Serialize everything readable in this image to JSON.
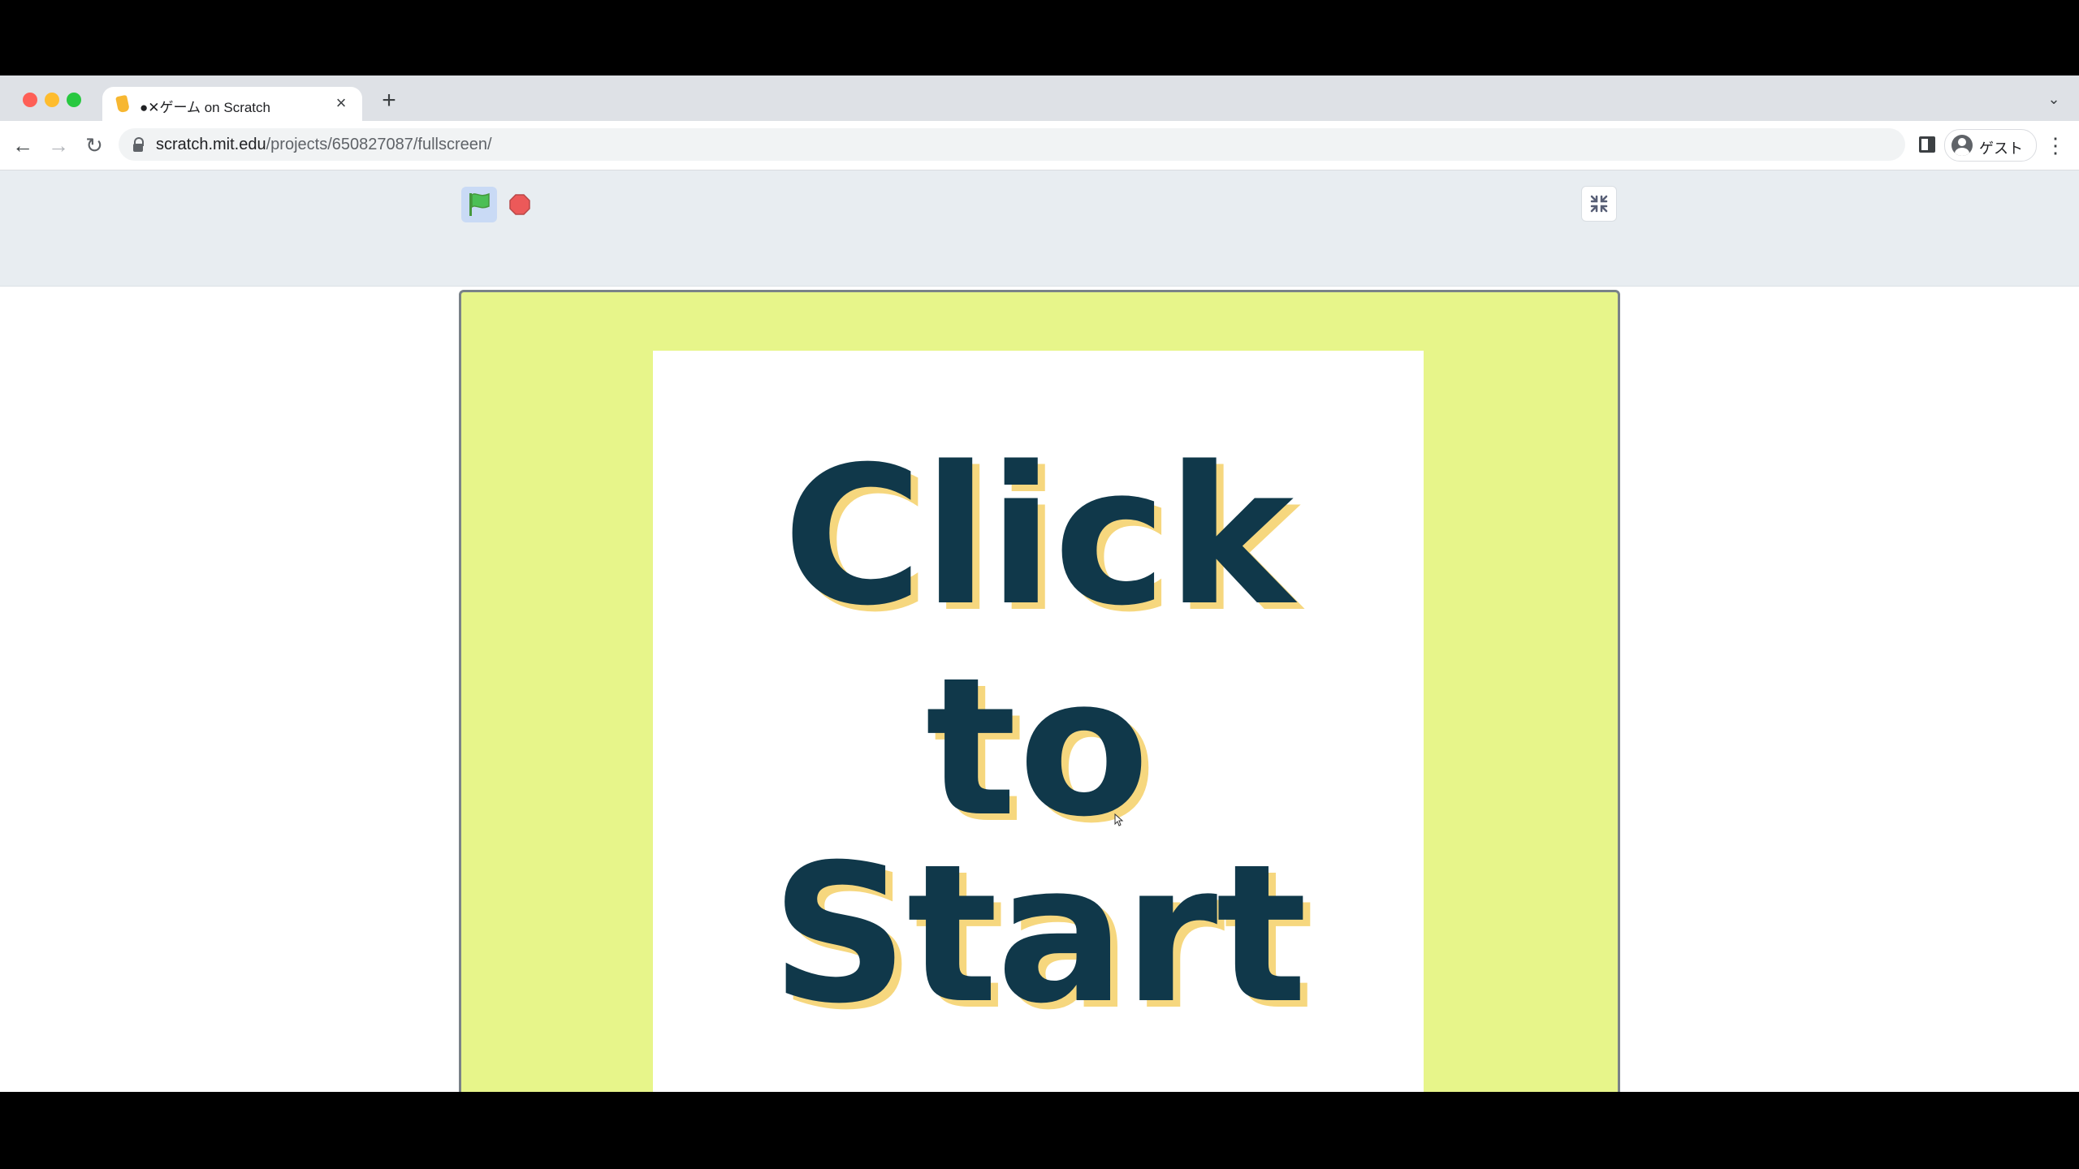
{
  "browser": {
    "tab": {
      "title": "●✕ゲーム on Scratch",
      "close_glyph": "×"
    },
    "new_tab_glyph": "+",
    "tab_list_glyph": "⌄",
    "nav": {
      "back_glyph": "←",
      "forward_glyph": "→",
      "reload_glyph": "↻"
    },
    "address": {
      "host": "scratch.mit.edu",
      "path": "/projects/650827087/fullscreen/"
    },
    "profile": {
      "name": "ゲスト"
    },
    "menu_glyph": "⋮"
  },
  "scratch": {
    "controls": {
      "green_flag_icon": "green-flag-icon",
      "stop_icon": "stop-icon",
      "unfullscreen_icon": "unfullscreen-icon"
    },
    "stage": {
      "lines": [
        "Click",
        "to",
        "Start"
      ]
    },
    "colors": {
      "stage_background": "#e7f58a",
      "text": "#10384a",
      "text_shadow": "#f6d77e",
      "flag_green": "#4cbf56",
      "stop_red": "#ec5959"
    }
  }
}
